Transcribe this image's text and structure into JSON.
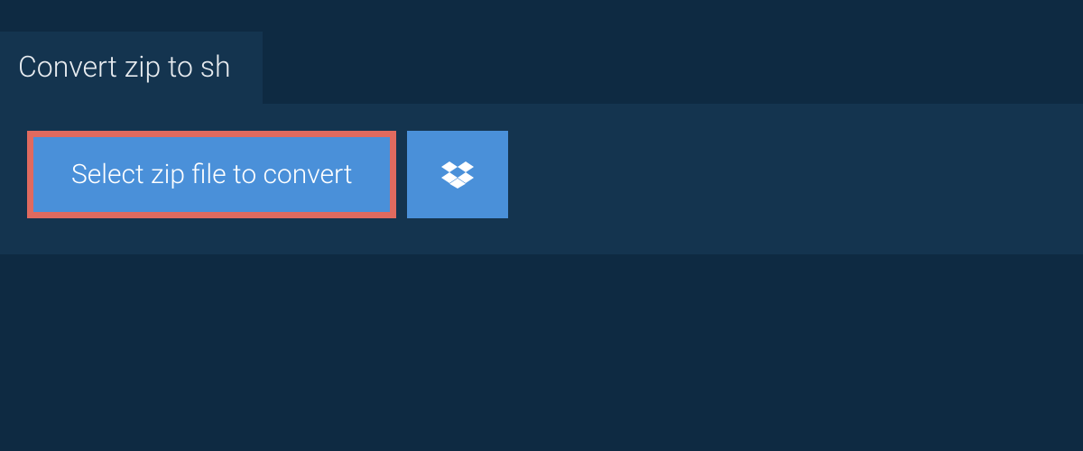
{
  "tab": {
    "title": "Convert zip to sh"
  },
  "actions": {
    "select_file_label": "Select zip file to convert",
    "dropbox_icon": "dropbox"
  },
  "colors": {
    "background": "#0e2a42",
    "panel": "#14344f",
    "button_bg": "#4a90d9",
    "button_border": "#e06a5f",
    "text_light": "#ffffff"
  }
}
